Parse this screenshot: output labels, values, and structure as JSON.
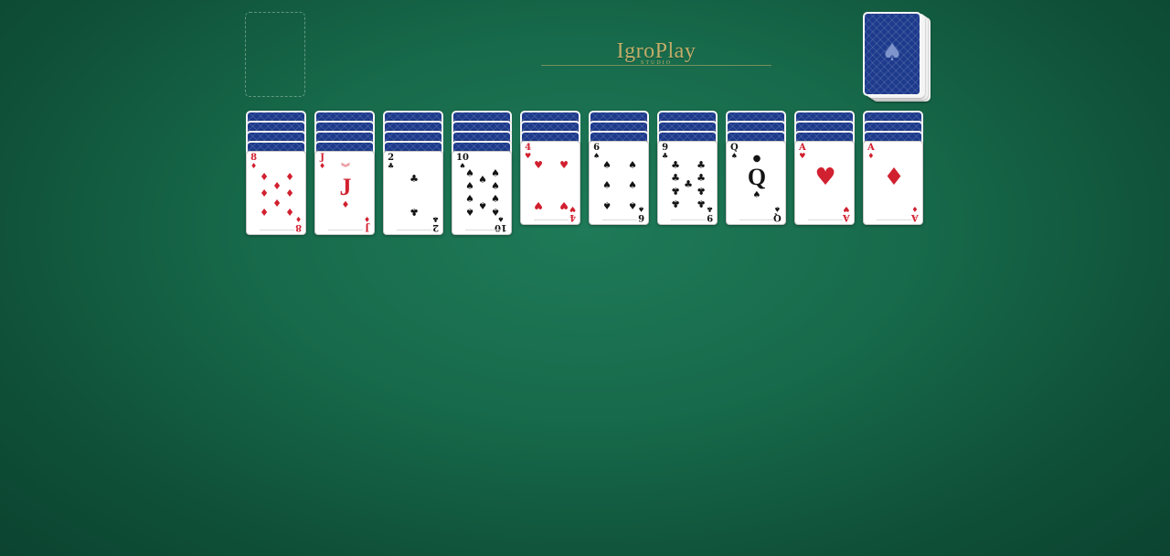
{
  "logo": {
    "title": "IgroPlay",
    "subtitle": "STUDIO"
  },
  "foundation": {
    "label": ""
  },
  "stock": {
    "icon": "spade-icon"
  },
  "colors": {
    "felt": "#176a4b",
    "card_back": "#1d3a8c",
    "red_suit": "#d1202f",
    "black_suit": "#141414",
    "logo_gold": "#c2ad6a"
  },
  "tableau": [
    {
      "backs": 4,
      "top": {
        "rank": "8",
        "suit": "♦",
        "color": "red"
      }
    },
    {
      "backs": 4,
      "top": {
        "rank": "J",
        "suit": "♦",
        "color": "red"
      }
    },
    {
      "backs": 4,
      "top": {
        "rank": "2",
        "suit": "♣",
        "color": "black"
      }
    },
    {
      "backs": 4,
      "top": {
        "rank": "10",
        "suit": "♠",
        "color": "black"
      }
    },
    {
      "backs": 3,
      "top": {
        "rank": "4",
        "suit": "♥",
        "color": "red"
      }
    },
    {
      "backs": 3,
      "top": {
        "rank": "6",
        "suit": "♠",
        "color": "black"
      }
    },
    {
      "backs": 3,
      "top": {
        "rank": "9",
        "suit": "♣",
        "color": "black"
      }
    },
    {
      "backs": 3,
      "top": {
        "rank": "Q",
        "suit": "♠",
        "color": "black"
      }
    },
    {
      "backs": 3,
      "top": {
        "rank": "A",
        "suit": "♥",
        "color": "red"
      }
    },
    {
      "backs": 3,
      "top": {
        "rank": "A",
        "suit": "♦",
        "color": "red"
      }
    }
  ]
}
